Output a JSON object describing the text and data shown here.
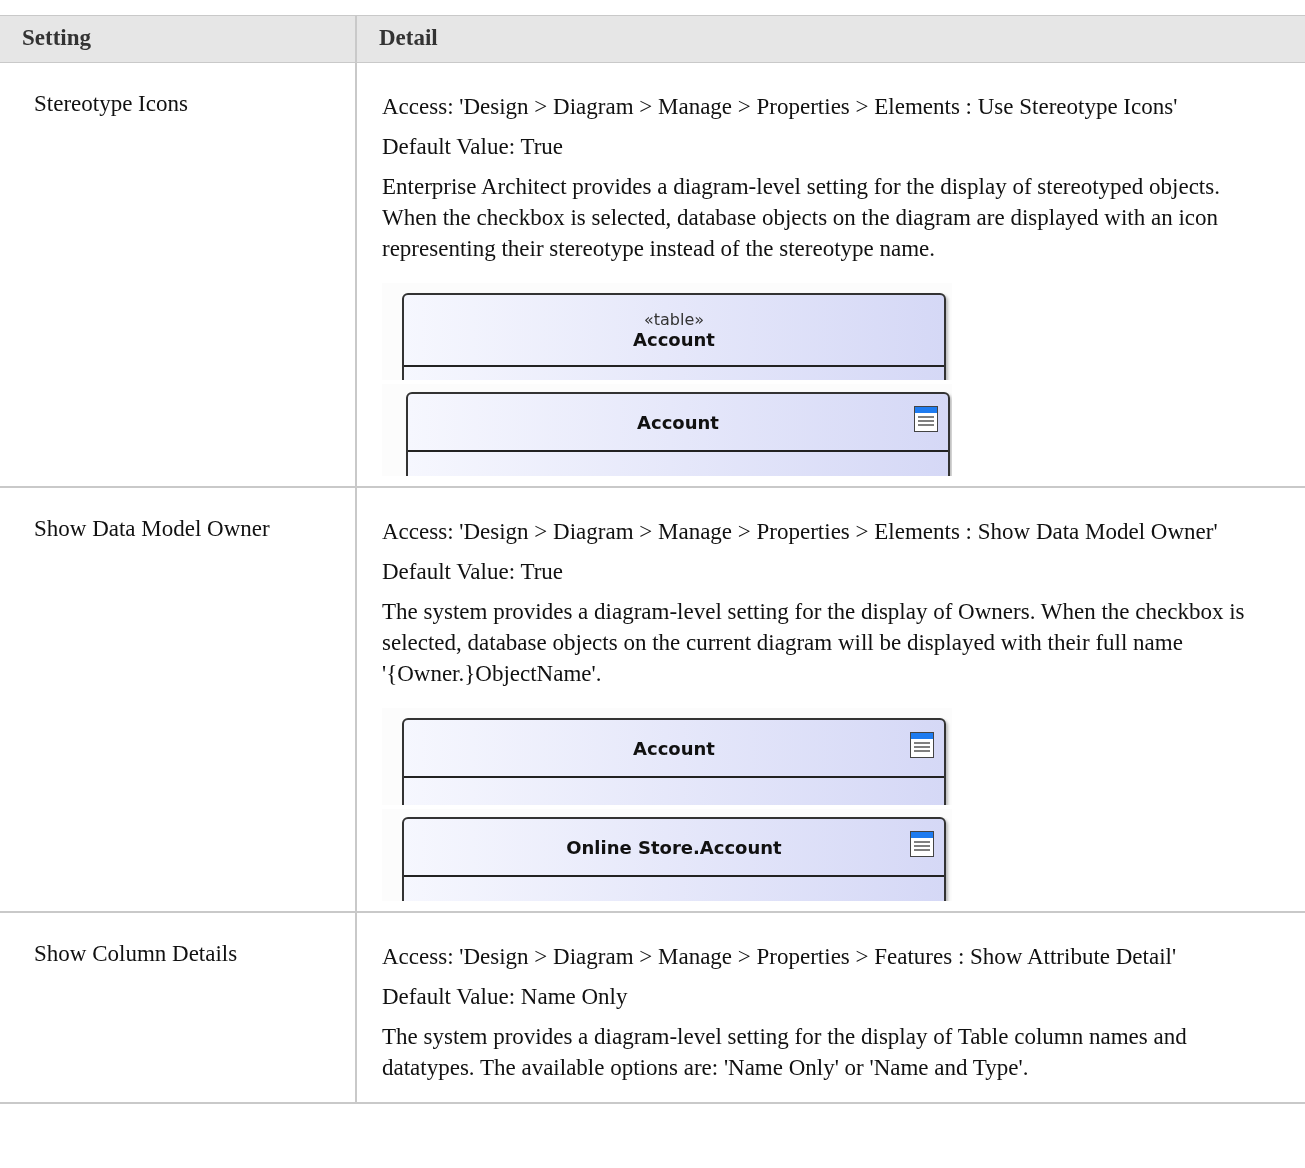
{
  "table": {
    "columns": [
      "Setting",
      "Detail"
    ],
    "rows": [
      {
        "setting": "Stereotype Icons",
        "access": "Access: 'Design > Diagram > Manage > Properties > Elements : Use Stereotype Icons'",
        "default": "Default Value: True",
        "description": "Enterprise Architect provides a diagram-level setting for the display of stereotyped objects. When the checkbox is selected, database objects on the diagram are displayed with an icon representing their stereotype instead of the stereotype name.",
        "diagrams": [
          {
            "stereotype": "«table»",
            "name": "Account",
            "icon": false
          },
          {
            "name": "Account",
            "icon": true
          }
        ]
      },
      {
        "setting": "Show Data Model Owner",
        "access": "Access: 'Design > Diagram > Manage > Properties > Elements : Show Data Model Owner'",
        "default": "Default Value: True",
        "description": "The system provides a diagram-level setting for the display of Owners. When the checkbox is selected, database objects on the current diagram will be displayed with their full name '{Owner.}ObjectName'.",
        "diagrams": [
          {
            "name": "Account",
            "icon": true
          },
          {
            "name": "Online Store.Account",
            "icon": true
          }
        ]
      },
      {
        "setting": "Show Column Details",
        "access": "Access: 'Design > Diagram > Manage > Properties > Features : Show Attribute Detail'",
        "default": "Default Value: Name Only",
        "description": "The system provides a diagram-level setting for the display of Table column names and datatypes. The available options are: 'Name Only' or 'Name and Type'."
      }
    ]
  }
}
